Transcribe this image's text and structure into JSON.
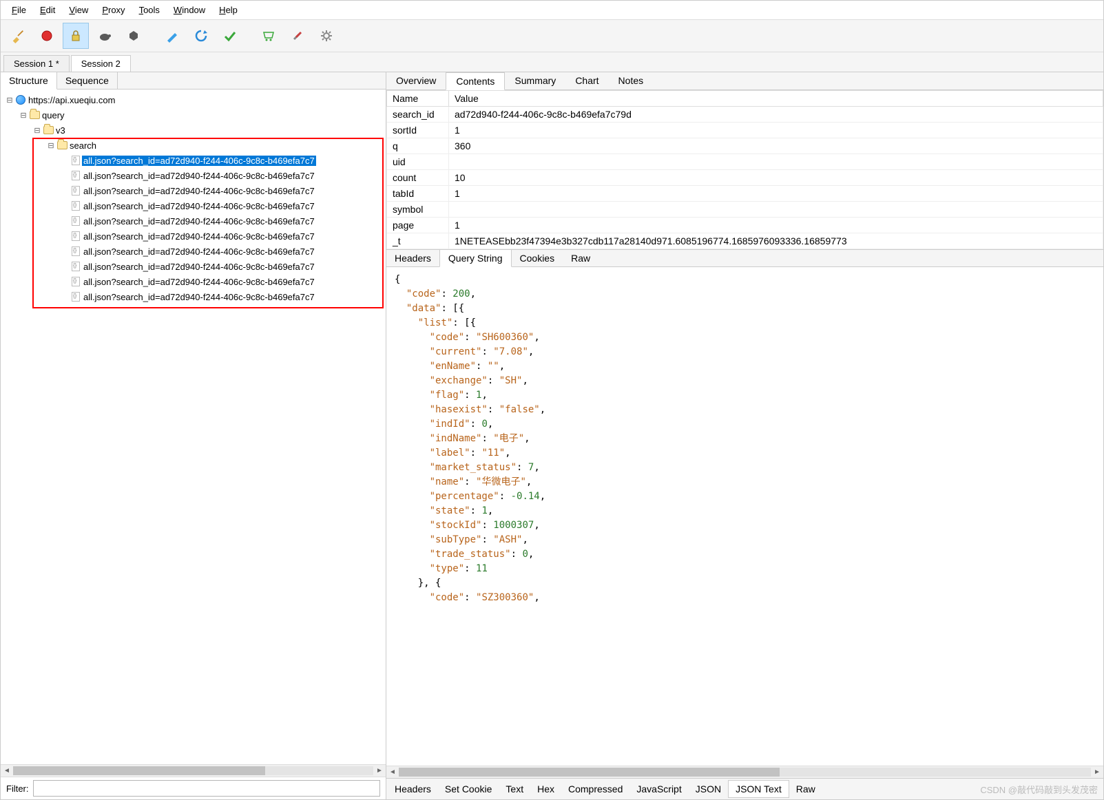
{
  "menubar": [
    "File",
    "Edit",
    "View",
    "Proxy",
    "Tools",
    "Window",
    "Help"
  ],
  "toolbar_icons": [
    "broom-icon",
    "record-icon",
    "lock-icon",
    "turtle-icon",
    "hex-icon",
    "pen-icon",
    "refresh-icon",
    "check-icon",
    "cart-icon",
    "tools-icon",
    "gear-icon"
  ],
  "session_tabs": {
    "items": [
      "Session 1 *",
      "Session 2"
    ],
    "active": 1
  },
  "left_tabs": {
    "items": [
      "Structure",
      "Sequence"
    ],
    "active": 0
  },
  "tree": {
    "root_url": "https://api.xueqiu.com",
    "query": "query",
    "v3": "v3",
    "search": "search",
    "requests": [
      "all.json?search_id=ad72d940-f244-406c-9c8c-b469efa7c7",
      "all.json?search_id=ad72d940-f244-406c-9c8c-b469efa7c7",
      "all.json?search_id=ad72d940-f244-406c-9c8c-b469efa7c7",
      "all.json?search_id=ad72d940-f244-406c-9c8c-b469efa7c7",
      "all.json?search_id=ad72d940-f244-406c-9c8c-b469efa7c7",
      "all.json?search_id=ad72d940-f244-406c-9c8c-b469efa7c7",
      "all.json?search_id=ad72d940-f244-406c-9c8c-b469efa7c7",
      "all.json?search_id=ad72d940-f244-406c-9c8c-b469efa7c7",
      "all.json?search_id=ad72d940-f244-406c-9c8c-b469efa7c7",
      "all.json?search_id=ad72d940-f244-406c-9c8c-b469efa7c7"
    ],
    "selected_index": 0
  },
  "filter_label": "Filter:",
  "filter_value": "",
  "right_tabs": {
    "items": [
      "Overview",
      "Contents",
      "Summary",
      "Chart",
      "Notes"
    ],
    "active": 1
  },
  "params_header": {
    "name": "Name",
    "value": "Value"
  },
  "params": [
    {
      "name": "search_id",
      "value": "ad72d940-f244-406c-9c8c-b469efa7c79d"
    },
    {
      "name": "sortId",
      "value": "1"
    },
    {
      "name": "q",
      "value": "360"
    },
    {
      "name": "uid",
      "value": ""
    },
    {
      "name": "count",
      "value": "10"
    },
    {
      "name": "tabId",
      "value": "1"
    },
    {
      "name": "symbol",
      "value": ""
    },
    {
      "name": "page",
      "value": "1"
    },
    {
      "name": "_t",
      "value": "1NETEASEbb23f47394e3b327cdb117a28140d971.6085196774.1685976093336.16859773"
    }
  ],
  "req_sub_tabs": {
    "items": [
      "Headers",
      "Query String",
      "Cookies",
      "Raw"
    ],
    "active": 1
  },
  "json_body": {
    "code": 200,
    "data_list_item": {
      "code": "SH600360",
      "current": "7.08",
      "enName": "",
      "exchange": "SH",
      "flag": 1,
      "hasexist": "false",
      "indId": 0,
      "indName": "电子",
      "label": "11",
      "market_status": 7,
      "name": "华微电子",
      "percentage": -0.14,
      "state": 1,
      "stockId": 1000307,
      "subType": "ASH",
      "trade_status": 0,
      "type": 11
    },
    "next_item_code": "SZ300360"
  },
  "resp_sub_tabs": {
    "items": [
      "Headers",
      "Set Cookie",
      "Text",
      "Hex",
      "Compressed",
      "JavaScript",
      "JSON",
      "JSON Text",
      "Raw"
    ],
    "active": 7
  },
  "watermark": "CSDN @敲代码敲到头发茂密"
}
